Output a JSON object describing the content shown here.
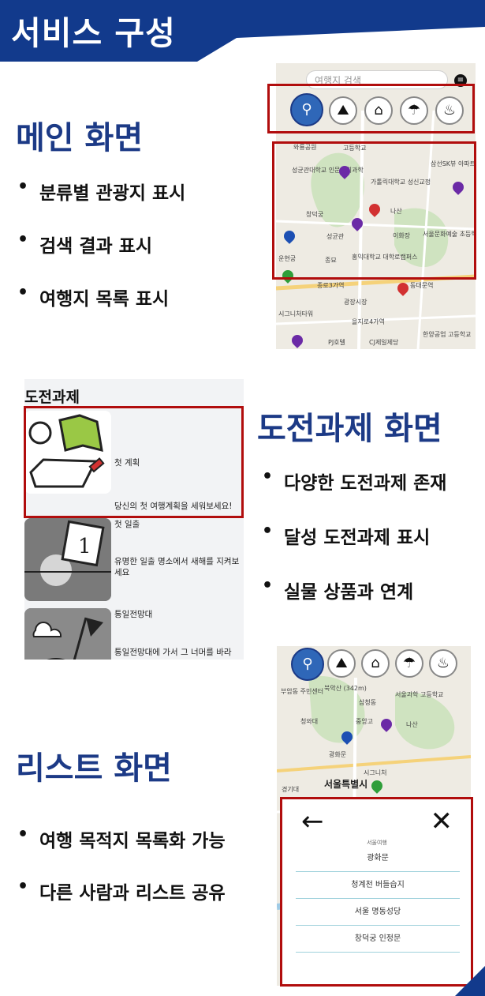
{
  "header": {
    "title": "서비스 구성"
  },
  "colors": {
    "navy": "#123a8c",
    "title_blue": "#1c3a86",
    "highlight_red": "#b10d0d"
  },
  "sections": [
    {
      "title": "메인 화면",
      "bullets": [
        "분류별 관광지 표시",
        "검색 결과 표시",
        "여행지 목록 표시"
      ]
    },
    {
      "title": "도전과제 화면",
      "bullets": [
        "다양한 도전과제 존재",
        "달성 도전과제 표시",
        "실물 상품과 연계"
      ]
    },
    {
      "title": "리스트 화면",
      "bullets": [
        "여행 목적지 목록화 가능",
        "다른 사람과 리스트 공유"
      ]
    }
  ],
  "main_screen": {
    "search_placeholder": "여행지 검색",
    "category_icons": [
      "map-icon",
      "nature-icon",
      "history-icon",
      "leisure-icon",
      "food-icon"
    ],
    "map_labels": [
      "와룡공원",
      "성균관대학교 인문사회과학",
      "고등학교",
      "가톨릭대학교 성신교정",
      "삼선SK뷰 아파트",
      "창덕궁",
      "성균관",
      "나산",
      "종묘",
      "홍익대학교 대학로캠퍼스",
      "이화장",
      "서울문화예술 초등학교",
      "운현궁",
      "종로3가역",
      "동대문역",
      "광장시장",
      "시그니처타워",
      "을지로4가역",
      "PJ호텔",
      "CJ제일제당",
      "한양공업 고등학교"
    ]
  },
  "challenge_screen": {
    "heading": "도전과제",
    "items": [
      {
        "name": "첫 계획",
        "desc": "당신의 첫 여행계획을 세워보세요!"
      },
      {
        "name": "첫 일출",
        "desc": "유명한 일출 명소에서 새해를 지켜보세요"
      },
      {
        "name": "통일전망대",
        "desc": "통일전망대에 가서 그 너머를 바라"
      }
    ]
  },
  "list_screen": {
    "map_labels": [
      "부암동 주민센터",
      "북악산 (342m)",
      "삼청동",
      "서울과학 고등학교",
      "청와대",
      "중앙고",
      "나산",
      "광화문",
      "서울특별시",
      "경기대",
      "시그니처"
    ],
    "list_caption": "서울여행",
    "list_items": [
      "광화문",
      "청계천 버들습지",
      "서울 명동성당",
      "창덕궁 인정문"
    ]
  }
}
